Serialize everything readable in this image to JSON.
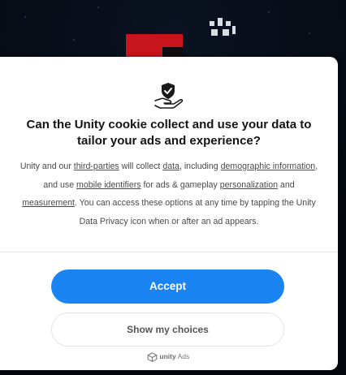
{
  "consent": {
    "title": "Can the Unity cookie collect and use your data to tailor your ads and experience?",
    "body": {
      "p1": "Unity and our ",
      "link_third_parties": "third-parties",
      "p2": " will collect ",
      "link_data": "data",
      "p3": ", including ",
      "link_demographic": "demographic information",
      "p4": ", and use ",
      "link_mobile_identifiers": "mobile identifiers",
      "p5": " for ads & gameplay ",
      "link_personalization": "personalization",
      "p6": " and ",
      "link_measurement": "measurement",
      "p7": ". You can access these options at any time by tapping the Unity Data Privacy icon when or after an ad appears."
    },
    "accept_label": "Accept",
    "choices_label": "Show my choices",
    "brand": {
      "unity": "unity",
      "ads": " Ads"
    }
  },
  "colors": {
    "accept": "#1a85f2",
    "game_red": "#c8141c"
  },
  "icons": {
    "consent": "hand-shield-check-icon",
    "brand": "unity-cube-icon"
  }
}
